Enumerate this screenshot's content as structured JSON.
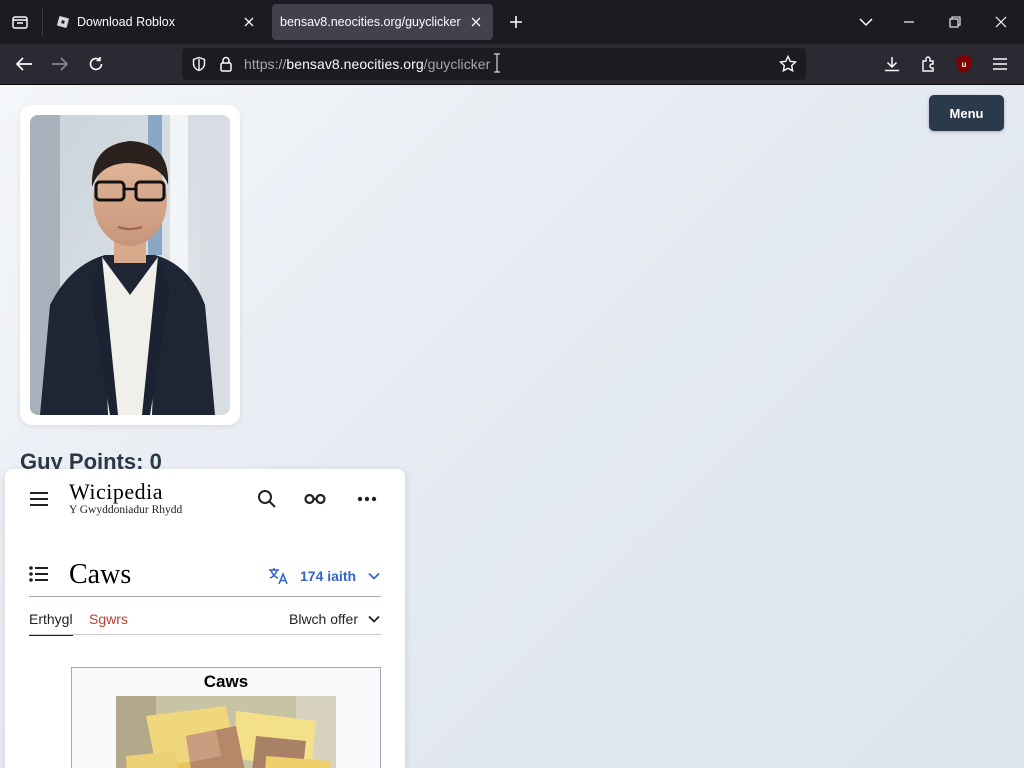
{
  "browser": {
    "tabs": [
      {
        "title": "Download Roblox",
        "active": false,
        "favicon": "roblox-icon"
      },
      {
        "title": "bensav8.neocities.org/guyclicker",
        "active": true,
        "favicon": ""
      }
    ],
    "url": {
      "scheme": "https://",
      "host": "bensav8.neocities.org",
      "path": "/guyclicker"
    },
    "ublock_badge": "1"
  },
  "page": {
    "points_label": "Guy Points:",
    "points_value": "0",
    "menu_label": "Menu"
  },
  "wiki": {
    "logo_title": "Wicipedia",
    "logo_tagline": "Y Gwyddoniadur Rhydd",
    "article_title": "Caws",
    "languages": "174 iaith",
    "tab_article": "Erthygl",
    "tab_talk": "Sgwrs",
    "tools": "Blwch offer",
    "infobox_title": "Caws"
  },
  "colors": {
    "tabstrip_bg": "#1c1b22",
    "navbar_bg": "#2b2a33",
    "menu_button": "#2b3a4a",
    "wiki_link": "#3366cc",
    "wiki_talk_link": "#bf3c2c"
  }
}
